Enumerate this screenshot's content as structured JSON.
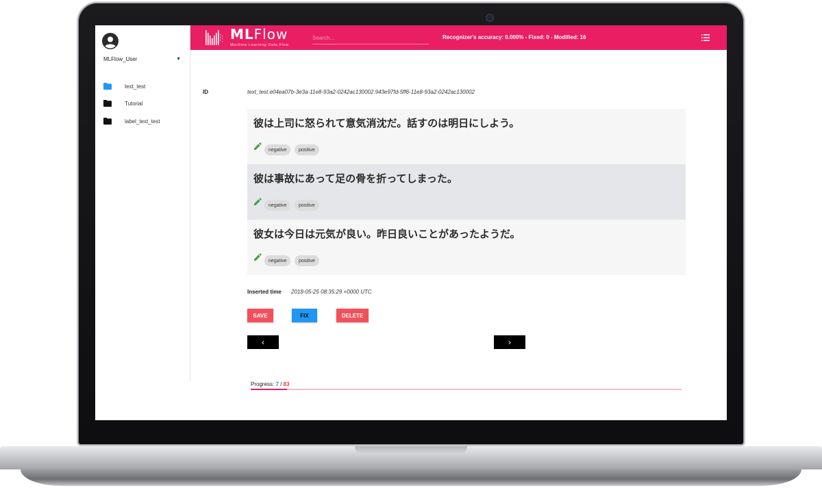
{
  "user": {
    "name": "MLFlow_User"
  },
  "sidebar": {
    "items": [
      {
        "label": "text_test",
        "active": true
      },
      {
        "label": "Tutorial",
        "active": false
      },
      {
        "label": "label_text_test",
        "active": false
      }
    ]
  },
  "header": {
    "brand_ml": "ML",
    "brand_flow": "Flow",
    "brand_subtitle": "Machine Learning Data Flow",
    "search_placeholder": "Search...",
    "stats": "Recognizer's accuracy: 0.000% - Fixed: 0 - Modified: 16"
  },
  "record": {
    "id_label": "ID",
    "id_value": "text_test.e04ea07b-3e3a-11e8-93a2-0242ac130002.943e97fd-5ff6-11e8-93a2-0242ac130002",
    "sentences": [
      {
        "text": "彼は上司に怒られて意気消沈だ。話すのは明日にしよう。",
        "labels": [
          "negative",
          "positive"
        ]
      },
      {
        "text": "彼は事故にあって足の骨を折ってしまった。",
        "labels": [
          "negative",
          "positive"
        ]
      },
      {
        "text": "彼女は今日は元気が良い。昨日良いことがあったようだ。",
        "labels": [
          "negative",
          "positive"
        ]
      }
    ],
    "inserted_label": "Inserted time",
    "inserted_value": "2018-05-25 08:35:29 +0000 UTC"
  },
  "actions": {
    "save_label": "SAVE",
    "fix_label": "FIX",
    "delete_label": "DELETE",
    "prev_icon": "‹",
    "next_icon": "›"
  },
  "progress": {
    "label": "Progress:",
    "current": "7",
    "separator": "/",
    "total": "83",
    "fraction": 0.084
  },
  "colors": {
    "brand": "#e91e63",
    "save": "#f4505a",
    "fix": "#2196f3",
    "delete": "#f4505a",
    "active_folder": "#2196f3",
    "edit_icon": "#43a047"
  },
  "icons": {
    "avatar": "account-circle-icon",
    "folder": "folder-icon",
    "edit": "pencil-icon",
    "menu": "list-menu-icon",
    "logo": "mlflow-logo-icon"
  }
}
